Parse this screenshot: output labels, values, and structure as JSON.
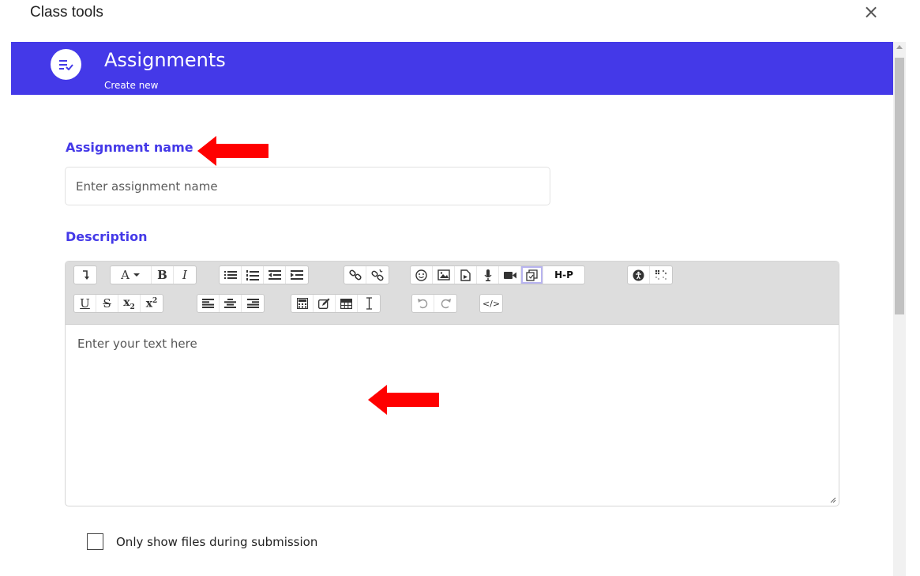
{
  "dialog": {
    "title": "Class tools",
    "close_glyph": "×"
  },
  "header": {
    "title": "Assignments",
    "subtitle": "Create new",
    "icon": "assignment-list-icon",
    "background": "#4439e8"
  },
  "form": {
    "name_label": "Assignment name",
    "name_placeholder": "Enter assignment name",
    "name_value": "",
    "description_label": "Description",
    "description_placeholder": "Enter your text here",
    "checkbox_label": "Only show files during submission",
    "checkbox_checked": false
  },
  "toolbar": {
    "row1": [
      [
        "toggle-toolbar-icon"
      ],
      [
        "font-color-icon",
        "bold-icon",
        "italic-icon"
      ],
      [
        "unordered-list-icon",
        "ordered-list-icon",
        "outdent-icon",
        "indent-icon"
      ],
      [
        "link-icon",
        "unlink-icon"
      ],
      [
        "emoji-icon",
        "image-icon",
        "media-icon",
        "record-audio-icon",
        "record-video-icon",
        "manage-files-icon",
        "h5p-icon"
      ],
      [
        "accessibility-checker-icon",
        "screenreader-helper-icon"
      ]
    ],
    "row2": [
      [
        "underline-icon",
        "strikethrough-icon",
        "subscript-icon",
        "superscript-icon"
      ],
      [
        "align-left-icon",
        "align-center-icon",
        "align-right-icon"
      ],
      [
        "equation-editor-icon",
        "special-character-icon",
        "table-icon",
        "clear-formatting-icon"
      ],
      [
        "undo-icon",
        "redo-icon"
      ],
      [
        "html-icon"
      ]
    ],
    "labels": {
      "font_color": "A",
      "bold": "B",
      "italic": "I",
      "underline": "U",
      "strike": "S",
      "subscript": "x",
      "superscript": "x",
      "sub_digit": "2",
      "sup_digit": "2",
      "h5p": "H-P",
      "html": "</>"
    }
  },
  "colors": {
    "accent": "#4439e8",
    "annotation_arrow": "#ff0000"
  }
}
